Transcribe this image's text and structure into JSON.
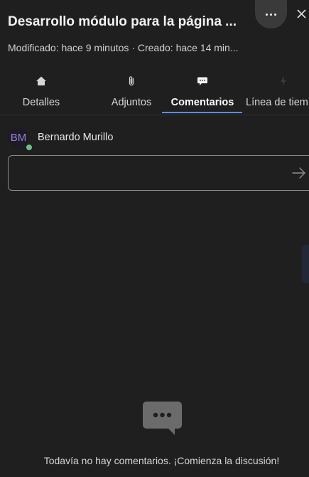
{
  "header": {
    "title": "Desarrollo módulo para la página ...",
    "subtitle": "Modificado: hace 9 minutos · Creado: hace 14 min..."
  },
  "tabs": [
    {
      "label": "Detalles",
      "icon": "home-icon"
    },
    {
      "label": "Adjuntos",
      "icon": "paperclip-icon"
    },
    {
      "label": "Comentarios",
      "icon": "comment-icon",
      "active": true
    },
    {
      "label": "Línea de tiem",
      "icon": "lightning-icon"
    }
  ],
  "user": {
    "initials": "BM",
    "name": "Bernardo Murillo",
    "status_color": "#6cc08b"
  },
  "comment_input": {
    "value": "",
    "placeholder": ""
  },
  "empty_state": {
    "message": "Todavía no hay comentarios. ¡Comienza la discusión!",
    "icon": "chat-bubble-icon"
  },
  "colors": {
    "background": "#1f1f1f",
    "accent": "#5a8ee8",
    "avatar_text": "#9b7fd6"
  }
}
